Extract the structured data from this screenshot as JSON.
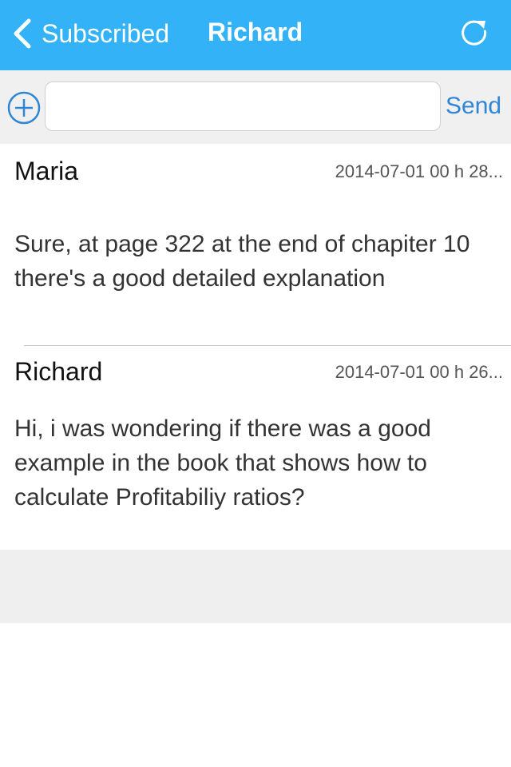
{
  "nav": {
    "back_label": "Subscribed",
    "title": "Richard",
    "back_icon": "chevron-left-icon",
    "refresh_icon": "refresh-icon",
    "bar_color": "#33b2f7"
  },
  "composer": {
    "add_icon": "plus-circle-icon",
    "input_value": "",
    "send_label": "Send"
  },
  "messages": [
    {
      "author": "Maria",
      "timestamp": "2014-07-01 00 h 28...",
      "text": "Sure, at page 322 at the end of chapiter 10 there's a good detailed explanation"
    },
    {
      "author": "Richard",
      "timestamp": "2014-07-01 00 h 26...",
      "text": "Hi, i was wondering if there was a good example in the book that shows how to calculate Profitabiliy ratios?"
    }
  ]
}
